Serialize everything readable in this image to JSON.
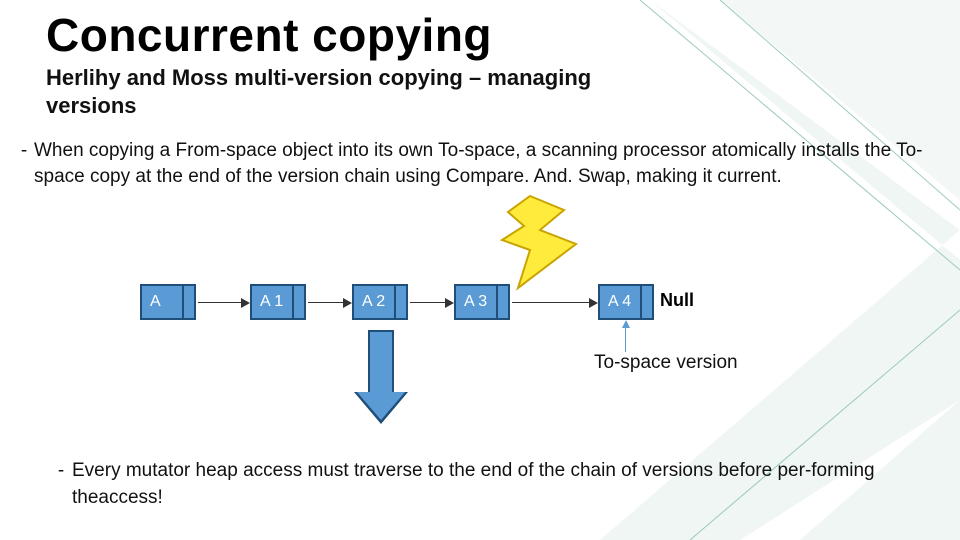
{
  "title": "Concurrent copying",
  "subtitle": "Herlihy and Moss multi-version copying – managing versions",
  "bullet1": "When copying a From-space object into its own To-space, a scanning processor atomically installs the To-space copy at the end of the version chain using Compare. And. Swap, making it current.",
  "bullet2": "Every mutator heap access must traverse to the end of the chain of versions before per-forming theaccess!",
  "boxes": {
    "a": "A",
    "a1": "A 1",
    "a2": "A 2",
    "a3": "A 3",
    "a4": "A 4"
  },
  "null_label": "Null",
  "to_space_label": "To-space version"
}
